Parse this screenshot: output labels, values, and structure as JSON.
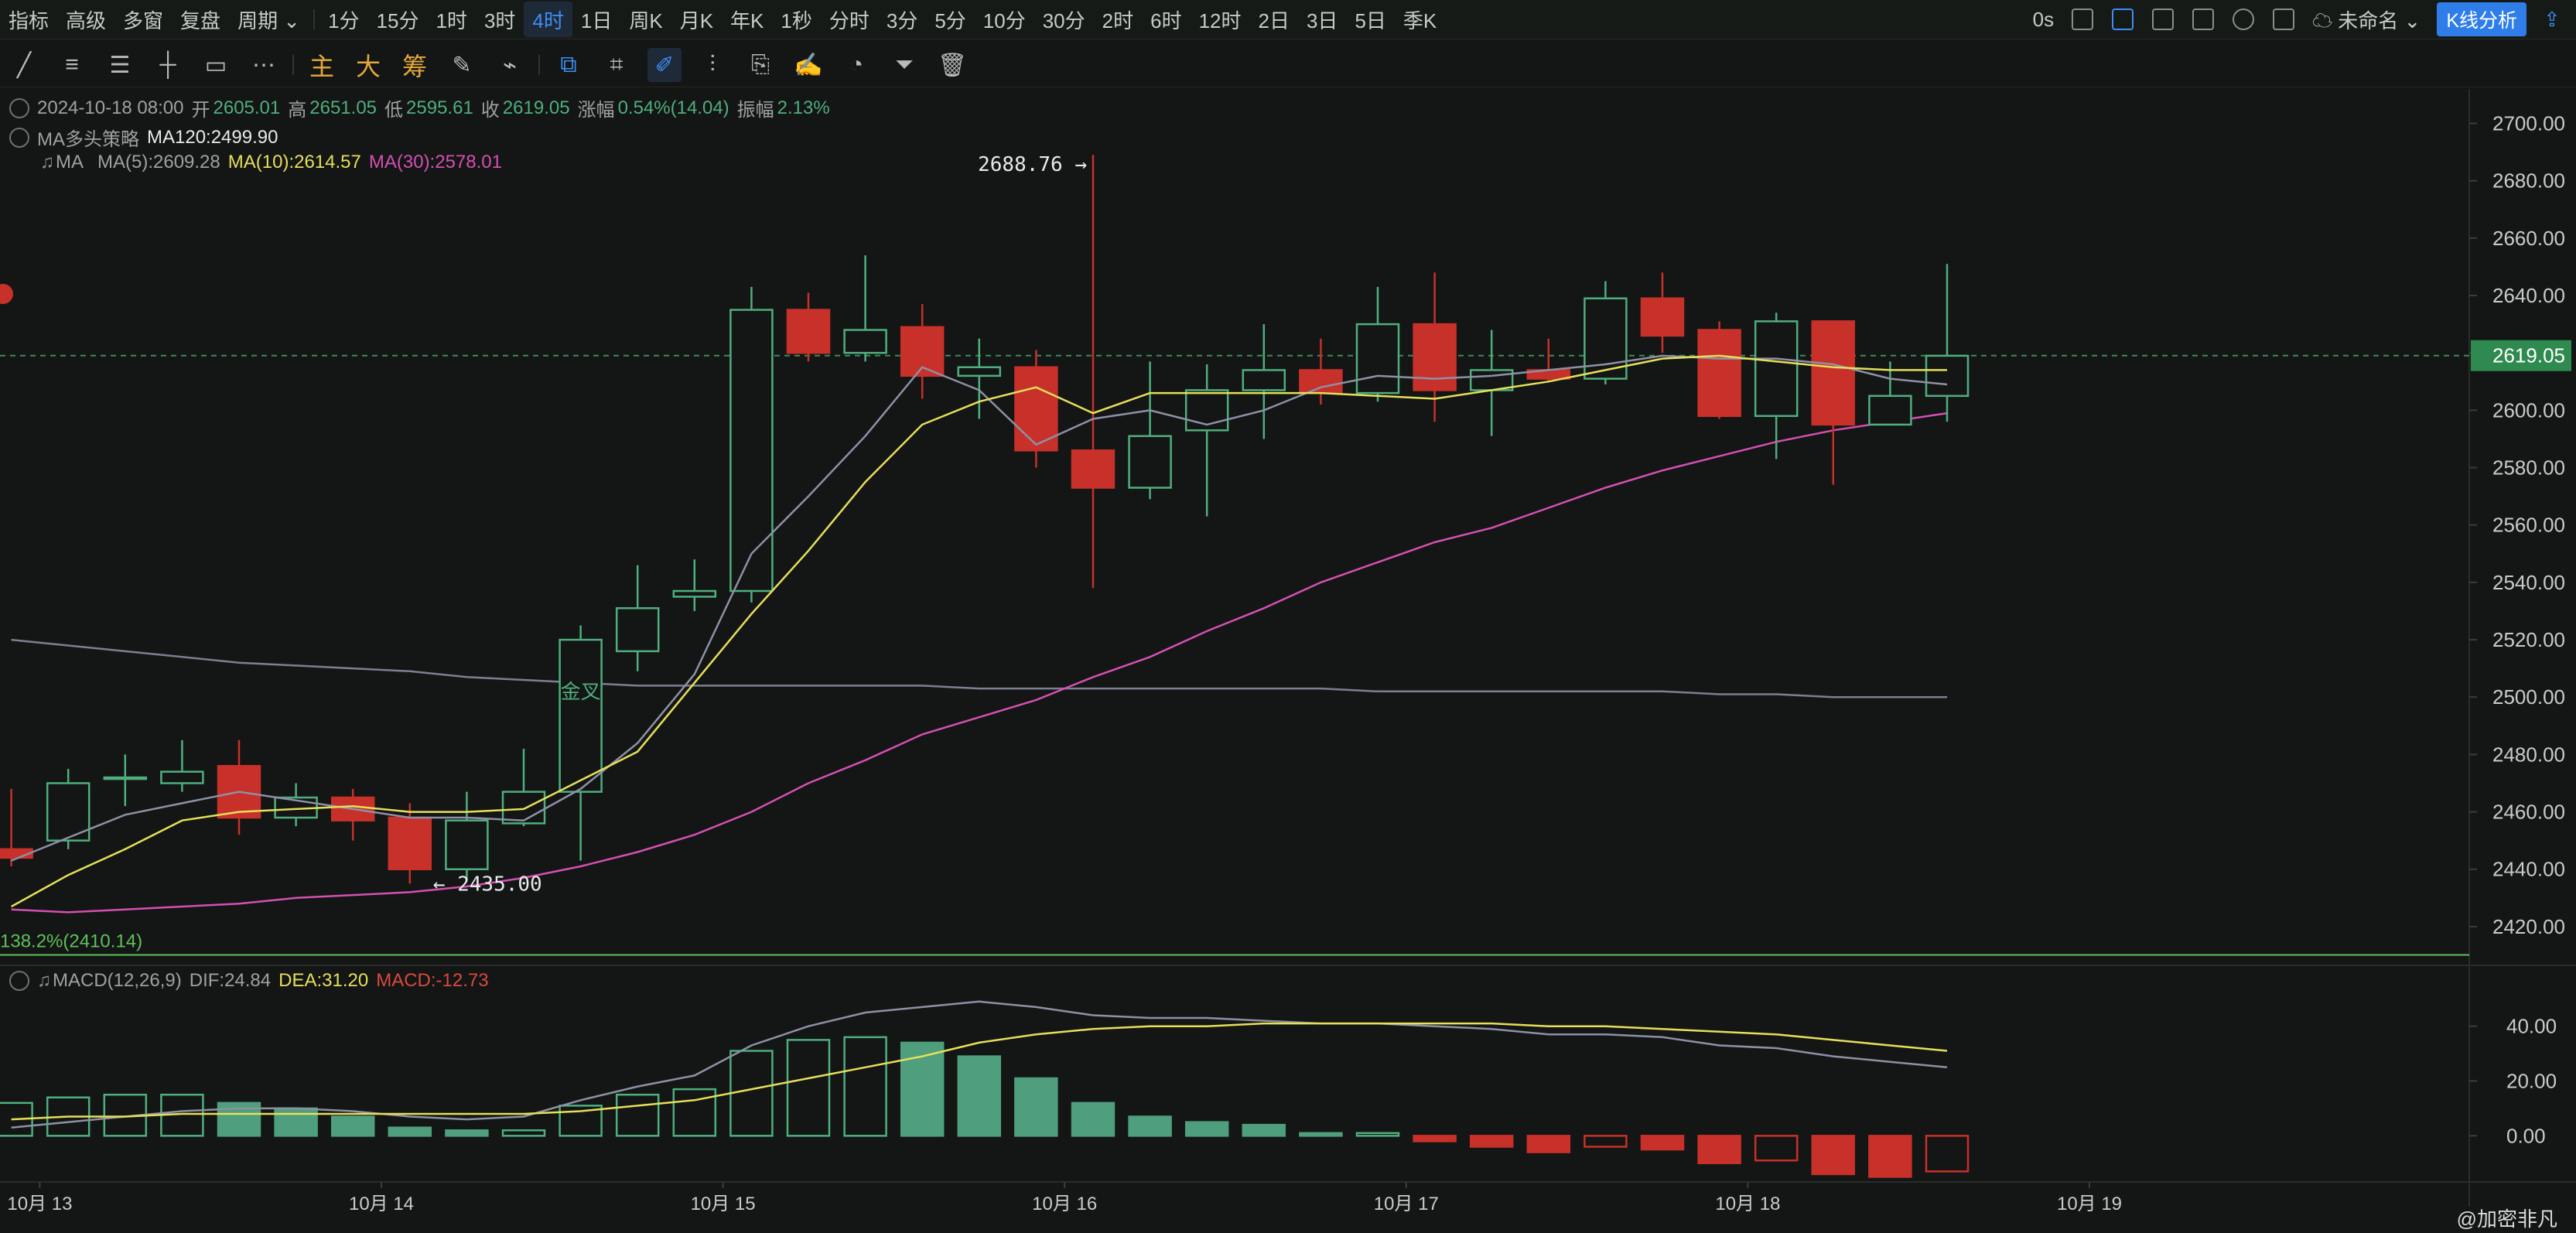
{
  "toolbar": {
    "items": [
      "指标",
      "高级",
      "多窗",
      "复盘",
      "周期",
      "1分",
      "15分",
      "1时",
      "3时",
      "4时",
      "1日",
      "周K",
      "月K",
      "年K",
      "1秒",
      "分时",
      "3分",
      "5分",
      "10分",
      "30分",
      "2时",
      "6时",
      "12时",
      "2日",
      "3日",
      "5日",
      "季K"
    ],
    "active_index": 9,
    "latency": "0s",
    "layout_name": "未命名",
    "kline_button": "K线分析"
  },
  "drawbar": {
    "text_buttons": [
      "主",
      "大",
      "筹"
    ]
  },
  "ohlc": {
    "date": "2024-10-18 08:00",
    "open_label": "开",
    "open": "2605.01",
    "high_label": "高",
    "high": "2651.05",
    "low_label": "低",
    "low": "2595.61",
    "close_label": "收",
    "close": "2619.05",
    "change_label": "涨幅",
    "change": "0.54%(14.04)",
    "amplitude_label": "振幅",
    "amplitude": "2.13%"
  },
  "strategy": {
    "name": "MA多头策略",
    "value": "MA120:2499.90"
  },
  "ma_legend": {
    "name": "MA",
    "ma5": "MA(5):2609.28",
    "ma10": "MA(10):2614.57",
    "ma30": "MA(30):2578.01"
  },
  "macd_legend": {
    "name": "MACD(12,26,9)",
    "dif": "DIF:24.84",
    "dea": "DEA:31.20",
    "macd": "MACD:-12.73"
  },
  "colors": {
    "up": "#4fae7e",
    "down": "#c8302a",
    "ma5": "#8e90a6",
    "ma10": "#e6df5a",
    "ma30": "#d64fb4",
    "ma120": "#7d7f92",
    "fib": "#5fc05a",
    "price_tag": "#2e8a4f"
  },
  "watermark": "@加密非凡",
  "chart_data": {
    "type": "candlestick",
    "y_axis": {
      "ticks": [
        "2700.00",
        "2680.00",
        "2660.00",
        "2640.00",
        "2620.00",
        "2600.00",
        "2580.00",
        "2560.00",
        "2540.00",
        "2520.00",
        "2500.00",
        "2480.00",
        "2460.00",
        "2440.00",
        "2420.00"
      ],
      "range": [
        2410,
        2712
      ]
    },
    "x_axis": {
      "labels": [
        "10月 13",
        "10月 14",
        "10月 15",
        "10月 16",
        "10月 17",
        "10月 18",
        "10月 19"
      ],
      "label_positions": [
        0.5,
        6.5,
        12.5,
        18.5,
        24.5,
        30.5,
        36.5
      ]
    },
    "last_price": "2619.05",
    "last_price_value": 2619.05,
    "annotations": [
      {
        "text": "2688.76",
        "type": "high",
        "index": 19,
        "value": 2688.76
      },
      {
        "text": "2435.00",
        "type": "low",
        "index": 7,
        "value": 2435.0
      },
      {
        "text": "金叉",
        "index": 10,
        "value": 2500
      }
    ],
    "fib_line": {
      "text": "138.2%(2410.14)",
      "value": 2410.14
    },
    "candles": [
      [
        2447,
        2444,
        2468,
        2441
      ],
      [
        2450,
        2470,
        2475,
        2447
      ],
      [
        2472,
        2472,
        2480,
        2462
      ],
      [
        2470,
        2474,
        2485,
        2467
      ],
      [
        2476,
        2458,
        2485,
        2452
      ],
      [
        2458,
        2465,
        2470,
        2455
      ],
      [
        2465,
        2457,
        2468,
        2450
      ],
      [
        2458,
        2440,
        2463,
        2435
      ],
      [
        2440,
        2457,
        2467,
        2436
      ],
      [
        2456,
        2467,
        2482,
        2455
      ],
      [
        2467,
        2520,
        2525,
        2443
      ],
      [
        2516,
        2531,
        2546,
        2509
      ],
      [
        2535,
        2537,
        2548,
        2530
      ],
      [
        2537,
        2635,
        2643,
        2533
      ],
      [
        2635,
        2620,
        2641,
        2617
      ],
      [
        2620,
        2628,
        2654,
        2617
      ],
      [
        2629,
        2612,
        2637,
        2604
      ],
      [
        2612,
        2615,
        2625,
        2597
      ],
      [
        2615,
        2586,
        2621,
        2580
      ],
      [
        2586,
        2573,
        2689,
        2538
      ],
      [
        2573,
        2591,
        2617,
        2569
      ],
      [
        2593,
        2607,
        2616,
        2563
      ],
      [
        2607,
        2614,
        2630,
        2590
      ],
      [
        2614,
        2606,
        2625,
        2602
      ],
      [
        2606,
        2630,
        2643,
        2603
      ],
      [
        2630,
        2607,
        2648,
        2596
      ],
      [
        2607,
        2614,
        2628,
        2591
      ],
      [
        2614,
        2611,
        2625,
        2610
      ],
      [
        2611,
        2639,
        2645,
        2609
      ],
      [
        2639,
        2626,
        2648,
        2620
      ],
      [
        2628,
        2598,
        2631,
        2597
      ],
      [
        2598,
        2631,
        2634,
        2583
      ],
      [
        2631,
        2595,
        2631,
        2574
      ],
      [
        2595,
        2605,
        2617,
        2595
      ],
      [
        2605,
        2619,
        2651,
        2596
      ]
    ],
    "ma5": [
      2443,
      2451,
      2459,
      2463,
      2467,
      2464,
      2461,
      2458,
      2458,
      2457,
      2468,
      2484,
      2508,
      2550,
      2570,
      2591,
      2615,
      2607,
      2588,
      2597,
      2600,
      2595,
      2600,
      2608,
      2612,
      2611,
      2612,
      2614,
      2616,
      2619,
      2618,
      2618,
      2616,
      2611,
      2609
    ],
    "ma10": [
      2427,
      2438,
      2447,
      2457,
      2460,
      2461,
      2462,
      2460,
      2460,
      2461,
      2471,
      2481,
      2505,
      2529,
      2551,
      2575,
      2595,
      2603,
      2608,
      2599,
      2606,
      2606,
      2606,
      2606,
      2605,
      2604,
      2607,
      2610,
      2614,
      2618,
      2619,
      2617,
      2615,
      2614,
      2614
    ],
    "ma30": [
      2426,
      2425,
      2426,
      2427,
      2428,
      2430,
      2431,
      2432,
      2434,
      2437,
      2441,
      2446,
      2452,
      2460,
      2470,
      2478,
      2487,
      2493,
      2499,
      2507,
      2514,
      2523,
      2531,
      2540,
      2547,
      2554,
      2559,
      2566,
      2573,
      2579,
      2584,
      2589,
      2593,
      2596,
      2599
    ],
    "ma120": [
      2520,
      2518,
      2516,
      2514,
      2512,
      2511,
      2510,
      2509,
      2507,
      2506,
      2505,
      2504,
      2504,
      2504,
      2504,
      2504,
      2504,
      2503,
      2503,
      2503,
      2503,
      2503,
      2503,
      2503,
      2502,
      2502,
      2502,
      2502,
      2502,
      2502,
      2501,
      2501,
      2500,
      2500,
      2500
    ],
    "macd": {
      "y_ticks": [
        "40.00",
        "20.00",
        "0.00"
      ],
      "range": [
        -16,
        56
      ],
      "hist": [
        12,
        14,
        15,
        15,
        12,
        10,
        7,
        3,
        2,
        2,
        11,
        15,
        17,
        31,
        35,
        36,
        34,
        29,
        21,
        12,
        7,
        5,
        4,
        1,
        1,
        -2,
        -4,
        -6,
        -4,
        -5,
        -10,
        -9,
        -14,
        -15,
        -13
      ],
      "dif": [
        3,
        5,
        7,
        9,
        10,
        10,
        9,
        7,
        6,
        7,
        13,
        18,
        22,
        33,
        40,
        45,
        47,
        49,
        47,
        44,
        43,
        43,
        42,
        41,
        41,
        40,
        39,
        37,
        37,
        36,
        33,
        32,
        29,
        27,
        25
      ],
      "dea": [
        6,
        7,
        7,
        8,
        8,
        8,
        8,
        8,
        8,
        8,
        9,
        11,
        13,
        17,
        21,
        25,
        29,
        34,
        37,
        39,
        40,
        40,
        41,
        41,
        41,
        41,
        41,
        40,
        40,
        39,
        38,
        37,
        35,
        33,
        31
      ]
    }
  }
}
